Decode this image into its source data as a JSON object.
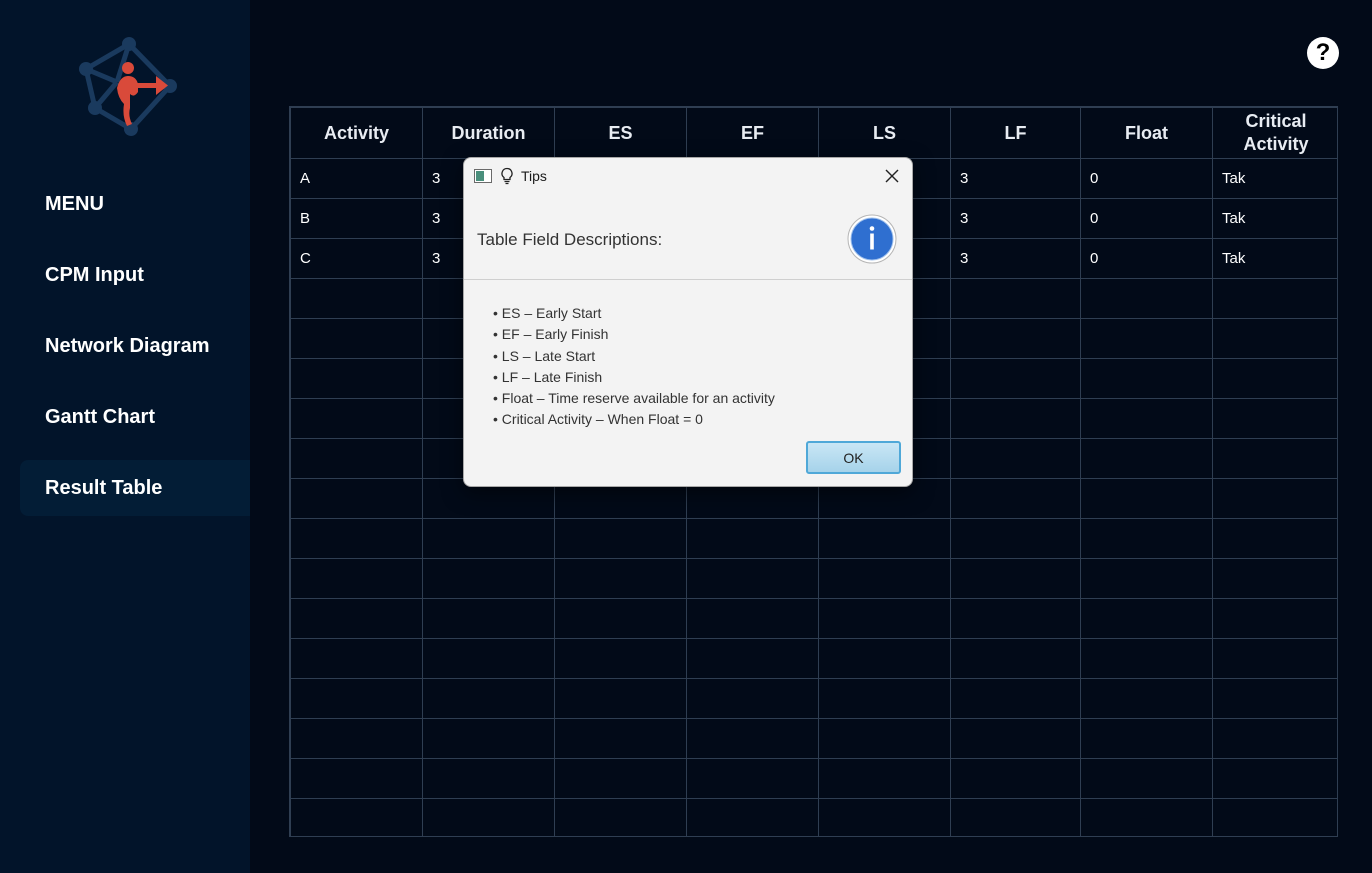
{
  "sidebar": {
    "logo": "cpm-network-logo",
    "menu_title": "MENU",
    "items": [
      {
        "label": "CPM Input"
      },
      {
        "label": "Network Diagram"
      },
      {
        "label": "Gantt Chart"
      },
      {
        "label": "Result Table",
        "active": true
      }
    ]
  },
  "help": {
    "icon": "help-circle-icon",
    "glyph": "?"
  },
  "table": {
    "headers": [
      "Activity",
      "Duration",
      "ES",
      "EF",
      "LS",
      "LF",
      "Float",
      "Critical Activity"
    ],
    "rows": [
      [
        "A",
        "3",
        "",
        "",
        "",
        "3",
        "0",
        "Tak"
      ],
      [
        "B",
        "3",
        "",
        "",
        "",
        "3",
        "0",
        "Tak"
      ],
      [
        "C",
        "3",
        "",
        "",
        "",
        "3",
        "0",
        "Tak"
      ]
    ]
  },
  "dialog": {
    "title": "Tips",
    "header": "Table Field Descriptions:",
    "lines": [
      "• ES – Early Start",
      "• EF – Early Finish",
      "• LS – Late Start",
      "• LF – Late Finish",
      "• Float – Time reserve available for an activity",
      "• Critical Activity – When Float = 0"
    ],
    "ok_label": "OK"
  },
  "colors": {
    "background": "#020a18",
    "sidebar": "#02142a",
    "sidebar_active": "#031d36",
    "grid_line": "#2f3e52",
    "logo_navy": "#1a3a5e",
    "logo_red": "#d94a3a",
    "dialog_bg": "#f3f3f3",
    "ok_border": "#4fa8d8",
    "info_blue": "#2f6fd0"
  }
}
